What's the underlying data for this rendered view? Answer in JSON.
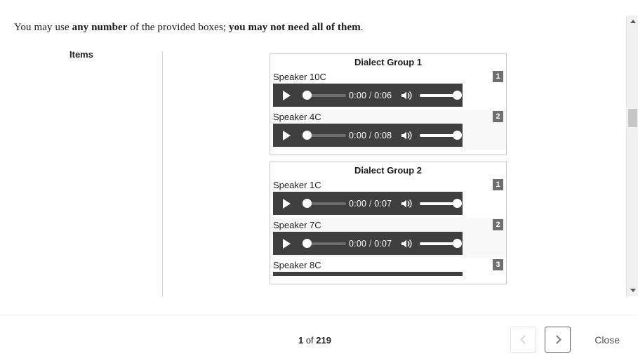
{
  "instruction": {
    "part1": "You may use ",
    "bold1": "any number",
    "part2": " of the provided boxes; ",
    "bold2": "you may not need all of them",
    "part3": "."
  },
  "items_column": {
    "title": "Items"
  },
  "groups": [
    {
      "title": "Dialect Group 1",
      "speakers": [
        {
          "label": "Speaker 10C",
          "badge": "1",
          "current_time": "0:00",
          "separator": "/",
          "duration": "0:06"
        },
        {
          "label": "Speaker 4C",
          "badge": "2",
          "current_time": "0:00",
          "separator": "/",
          "duration": "0:08"
        }
      ]
    },
    {
      "title": "Dialect Group 2",
      "speakers": [
        {
          "label": "Speaker 1C",
          "badge": "1",
          "current_time": "0:00",
          "separator": "/",
          "duration": "0:07"
        },
        {
          "label": "Speaker 7C",
          "badge": "2",
          "current_time": "0:00",
          "separator": "/",
          "duration": "0:07"
        },
        {
          "label": "Speaker 8C",
          "badge": "3",
          "current_time": "",
          "separator": "",
          "duration": ""
        }
      ]
    }
  ],
  "footer": {
    "page_current": "1",
    "page_of": " of ",
    "page_total": "219",
    "prev_label": "Previous",
    "next_label": "Next",
    "close_label": "Close"
  },
  "colors": {
    "player_bg": "#3f3f3f",
    "badge_bg": "#6e6e6e",
    "alt_row_bg": "#f8f8f8",
    "group_border": "#c8c8c8",
    "scroll_thumb": "#c6c6c6",
    "next_border": "#636363",
    "prev_border": "#e2e2e2"
  },
  "icons": {
    "play": "play-icon",
    "volume": "volume-icon",
    "scroll_up": "chevron-up-icon",
    "scroll_down": "chevron-down-icon",
    "prev": "chevron-left-icon",
    "next": "chevron-right-icon"
  }
}
